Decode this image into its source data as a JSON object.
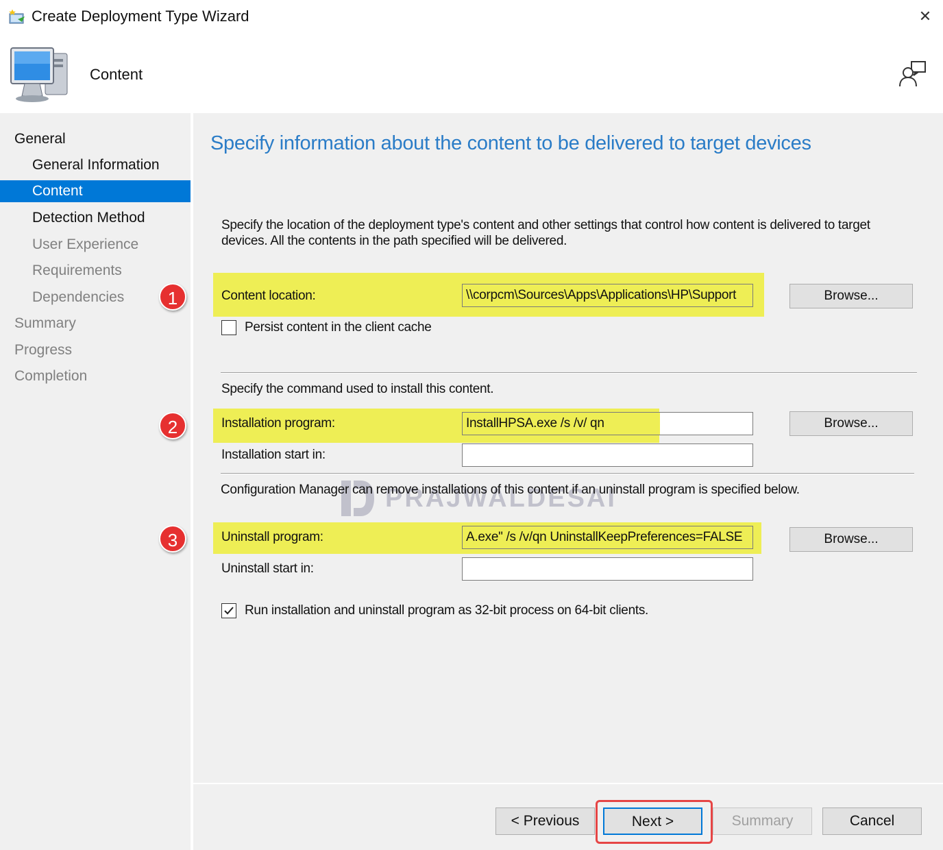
{
  "window": {
    "title": "Create Deployment Type Wizard",
    "close_glyph": "✕"
  },
  "header": {
    "title": "Content"
  },
  "nav": {
    "items": [
      {
        "label": "General",
        "level": 0,
        "state": "dark"
      },
      {
        "label": "General Information",
        "level": 1,
        "state": "dark"
      },
      {
        "label": "Content",
        "level": 1,
        "state": "selected"
      },
      {
        "label": "Detection Method",
        "level": 1,
        "state": "dark"
      },
      {
        "label": "User Experience",
        "level": 1,
        "state": "grey"
      },
      {
        "label": "Requirements",
        "level": 1,
        "state": "grey"
      },
      {
        "label": "Dependencies",
        "level": 1,
        "state": "grey"
      },
      {
        "label": "Summary",
        "level": 0,
        "state": "grey"
      },
      {
        "label": "Progress",
        "level": 0,
        "state": "grey"
      },
      {
        "label": "Completion",
        "level": 0,
        "state": "grey"
      }
    ]
  },
  "main": {
    "heading": "Specify information about the content to be delivered to target devices",
    "description_line1": "Specify the location of the deployment type's content and other settings that control how content is delivered to target",
    "description_line2": "devices. All the contents in the path specified will be delivered.",
    "content_location": {
      "label": "Content location:",
      "value": "\\\\corpcm\\Sources\\Apps\\Applications\\HP\\Support",
      "browse": "Browse..."
    },
    "persist_cache": {
      "label": "Persist content in the client cache",
      "checked": false
    },
    "install_command_text": "Specify the command used to install this content.",
    "installation_program": {
      "label": "Installation program:",
      "value": "InstallHPSA.exe /s /v/ qn",
      "browse": "Browse..."
    },
    "installation_start_in": {
      "label": "Installation start in:",
      "value": ""
    },
    "uninstall_text": "Configuration Manager can remove installations of this content if an uninstall program is specified below.",
    "uninstall_program": {
      "label": "Uninstall program:",
      "value": "A.exe\" /s /v/qn UninstallKeepPreferences=FALSE",
      "browse": "Browse..."
    },
    "uninstall_start_in": {
      "label": "Uninstall start in:",
      "value": ""
    },
    "run_32bit": {
      "label": "Run installation and uninstall program as 32-bit process on 64-bit clients.",
      "checked": true
    }
  },
  "markers": [
    "1",
    "2",
    "3"
  ],
  "watermark": "PRAJWALDESAI",
  "footer": {
    "previous": "< Previous",
    "next": "Next >",
    "summary": "Summary",
    "cancel": "Cancel"
  },
  "colors": {
    "accent": "#0078d7",
    "heading": "#2a7cc7",
    "highlight": "#eeee55",
    "marker": "#e63030"
  }
}
